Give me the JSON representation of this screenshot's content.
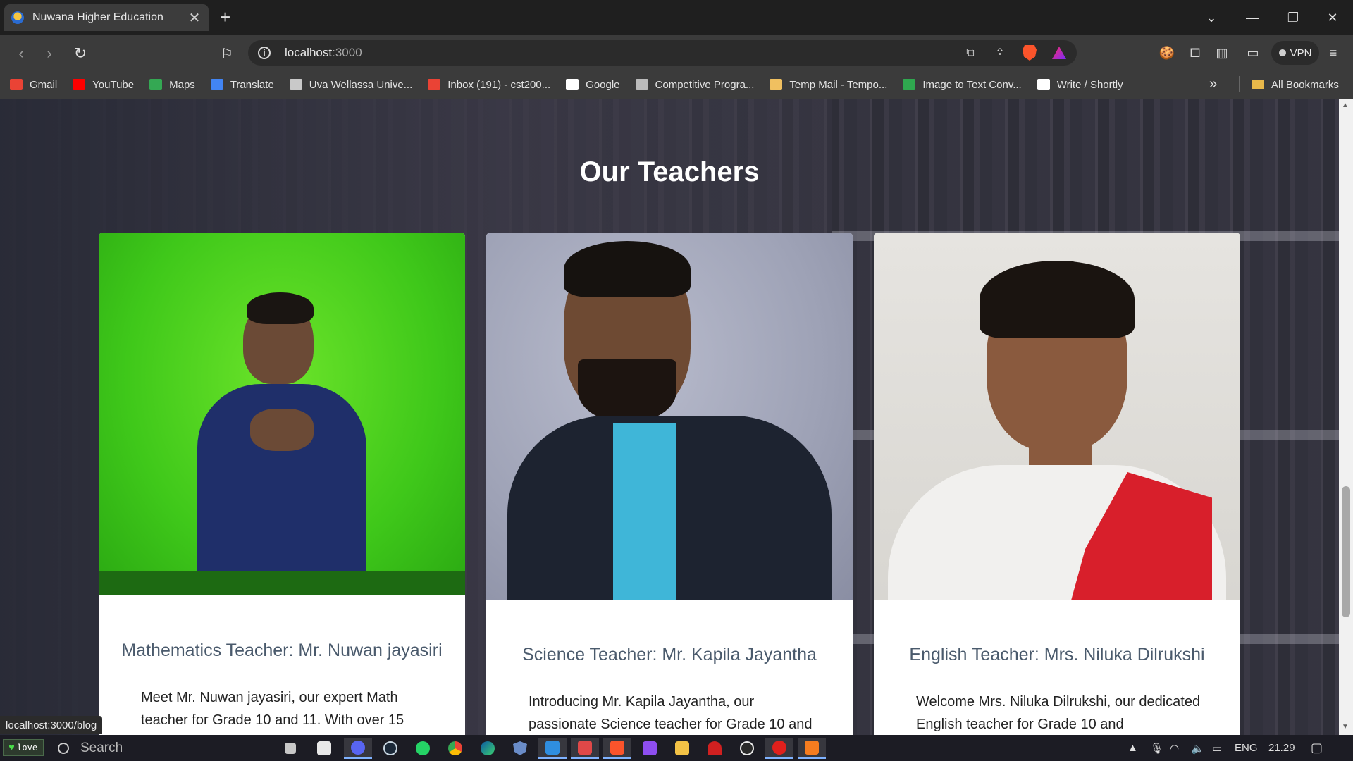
{
  "browser": {
    "tab_title": "Nuwana Higher Education",
    "close_glyph": "✕",
    "new_tab_glyph": "+",
    "url_host": "localhost",
    "url_port": ":3000",
    "vpn_label": "VPN",
    "bookmarks": [
      {
        "label": "Gmail",
        "icon": "gmail-icon",
        "color": "#ea4335"
      },
      {
        "label": "YouTube",
        "icon": "youtube-icon",
        "color": "#ff0000"
      },
      {
        "label": "Maps",
        "icon": "maps-icon",
        "color": "#34a853"
      },
      {
        "label": "Translate",
        "icon": "translate-icon",
        "color": "#4285f4"
      },
      {
        "label": "Uva Wellassa Unive...",
        "icon": "university-icon",
        "color": "#c9c9c9"
      },
      {
        "label": "Inbox (191) - cst200...",
        "icon": "gmail-icon",
        "color": "#ea4335"
      },
      {
        "label": "Google",
        "icon": "google-icon",
        "color": "#ffffff"
      },
      {
        "label": "Competitive Progra...",
        "icon": "cc-icon",
        "color": "#bbbbbb"
      },
      {
        "label": "Temp Mail - Tempo...",
        "icon": "mail-icon",
        "color": "#f0c060"
      },
      {
        "label": "Image to Text Conv...",
        "icon": "image-text-icon",
        "color": "#2fa84f"
      },
      {
        "label": "Write / Shortly",
        "icon": "shortly-icon",
        "color": "#ffffff"
      }
    ],
    "all_bookmarks": "All Bookmarks",
    "status_url": "localhost:3000/blog"
  },
  "page": {
    "section_title": "Our Teachers",
    "teachers": [
      {
        "title": "Mathematics Teacher: Mr. Nuwan jayasiri",
        "description": "Meet Mr. Nuwan jayasiri, our expert Math teacher for Grade 10 and 11. With over 15"
      },
      {
        "title": "Science Teacher: Mr. Kapila Jayantha",
        "description": "Introducing Mr. Kapila Jayantha, our passionate Science teacher for Grade 10 and"
      },
      {
        "title": "English Teacher: Mrs. Niluka Dilrukshi",
        "description": "Welcome Mrs. Niluka Dilrukshi, our dedicated English teacher for Grade 10 and"
      }
    ]
  },
  "taskbar": {
    "love_label": "love",
    "search_placeholder": "Search",
    "language": "ENG",
    "time": "21.29"
  }
}
